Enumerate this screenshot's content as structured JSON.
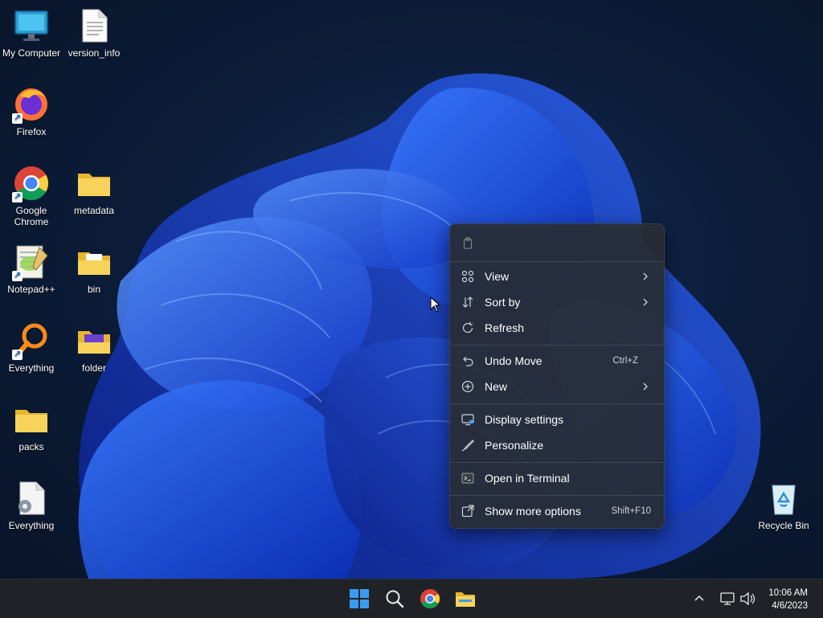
{
  "desktop": {
    "icons": {
      "my_computer": "My Computer",
      "version_info": "version_info",
      "firefox": "Firefox",
      "chrome_line1": "Google",
      "chrome_line2": "Chrome",
      "metadata": "metadata",
      "notepad": "Notepad++",
      "bin": "bin",
      "everything1": "Everything",
      "folder": "folder",
      "packs": "packs",
      "everything2": "Everything",
      "recycle_bin": "Recycle Bin"
    }
  },
  "context_menu": {
    "view": "View",
    "sort_by": "Sort by",
    "refresh": "Refresh",
    "undo_move": "Undo Move",
    "undo_shortcut": "Ctrl+Z",
    "new": "New",
    "display_settings": "Display settings",
    "personalize": "Personalize",
    "open_terminal": "Open in Terminal",
    "show_more": "Show more options",
    "show_more_shortcut": "Shift+F10"
  },
  "taskbar": {
    "time": "10:06 AM",
    "date": "4/6/2023"
  },
  "colors": {
    "accent": "#2f7cf6",
    "folder": "#f4c542",
    "menu_bg": "#2b2f36",
    "taskbar_bg": "#1f2328"
  }
}
